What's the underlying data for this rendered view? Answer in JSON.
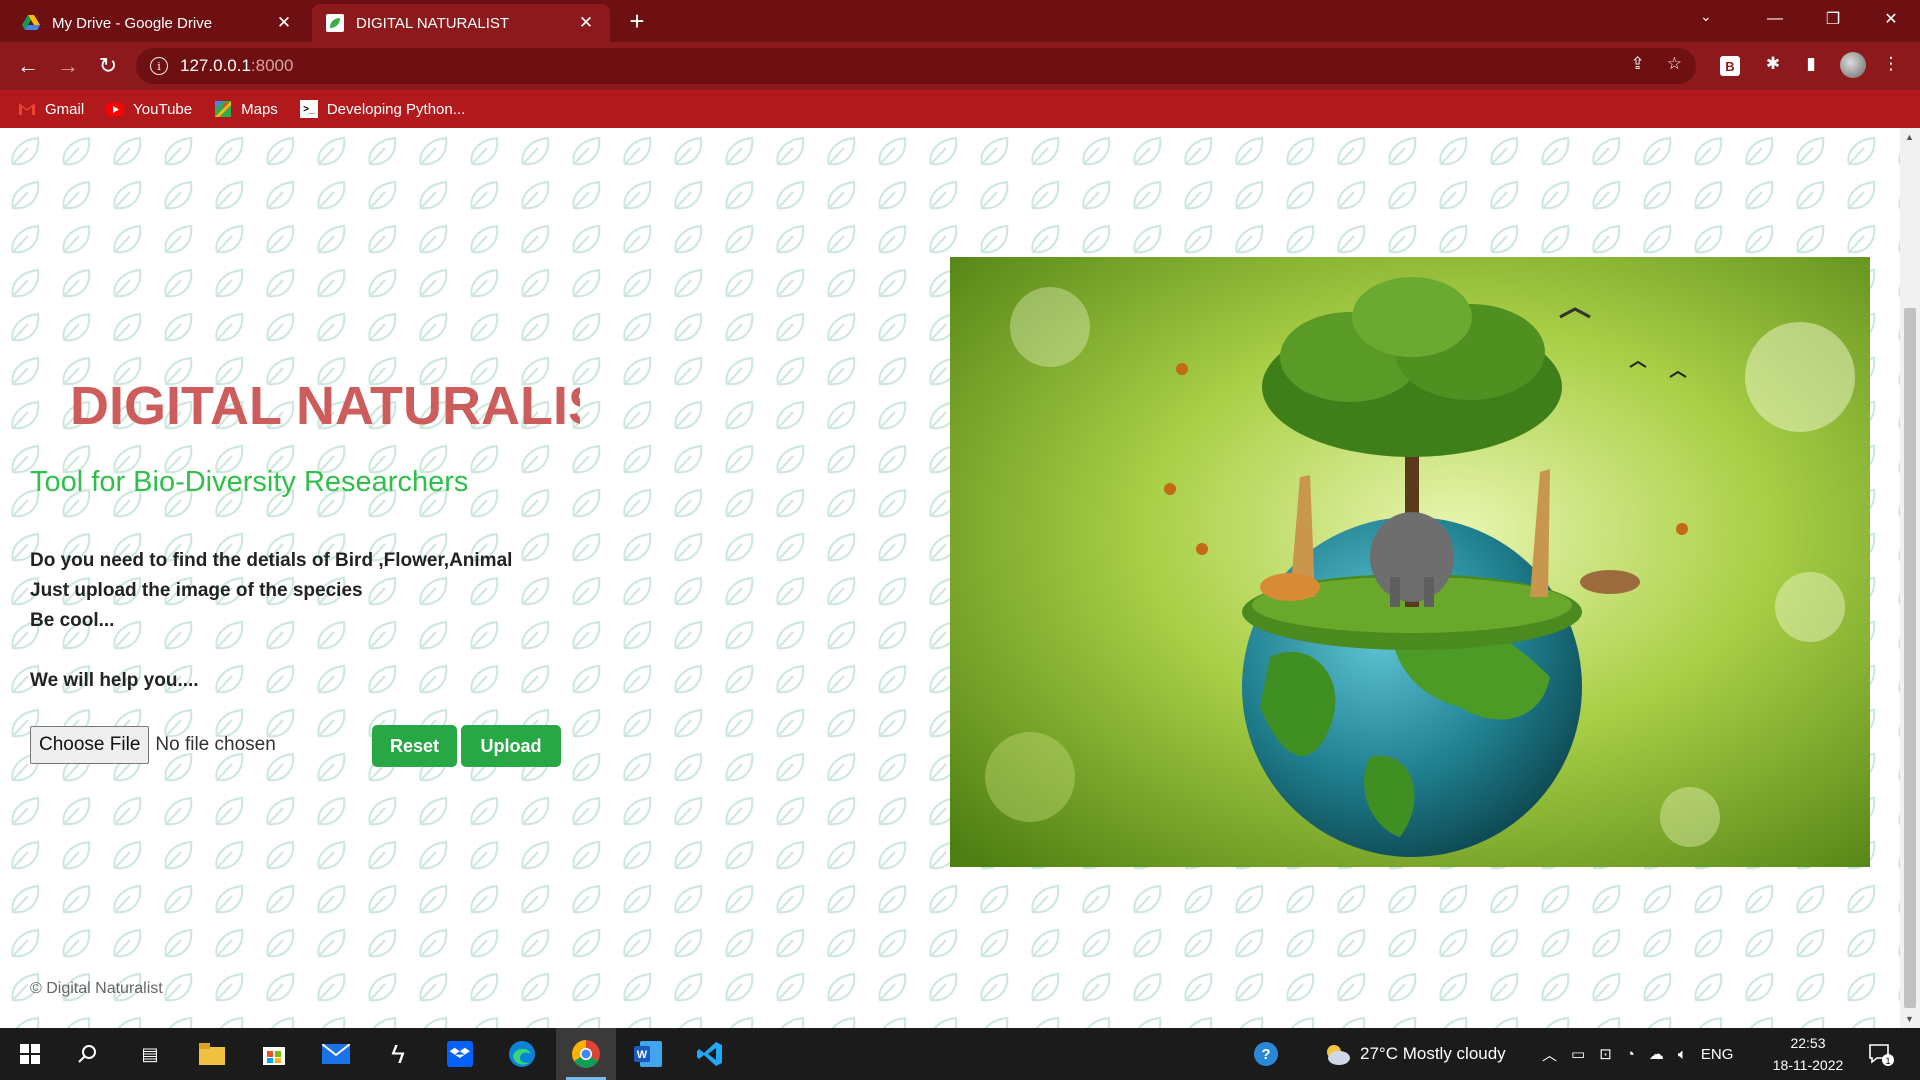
{
  "browser": {
    "tabs": [
      {
        "title": "My Drive - Google Drive",
        "favicon": "google-drive-icon",
        "active": false
      },
      {
        "title": "DIGITAL NATURALIST",
        "favicon": "leaf-favicon",
        "active": true
      }
    ],
    "address": {
      "host": "127.0.0.1",
      "port": ":8000"
    },
    "bookmarks": [
      {
        "label": "Gmail",
        "icon": "gmail-icon"
      },
      {
        "label": "YouTube",
        "icon": "youtube-icon"
      },
      {
        "label": "Maps",
        "icon": "maps-icon"
      },
      {
        "label": "Developing Python...",
        "icon": "terminal-icon"
      }
    ],
    "extension_badge": "B"
  },
  "page": {
    "brand": "DIGITAL NATURALIS",
    "subtitle": "Tool for Bio-Diversity Researchers",
    "intro": {
      "line1": "Do you need to find the detials of Bird ,Flower,Animal",
      "line2": "Just upload the image of the species",
      "line3": "Be cool...",
      "line4": "We will help you...."
    },
    "file_input": {
      "button": "Choose File",
      "status": "No file chosen"
    },
    "reset_label": "Reset",
    "upload_label": "Upload",
    "footer": "© Digital Naturalist",
    "colors": {
      "brand": "#cd5c5c",
      "subtitle": "#2fbf4a",
      "button": "#28a745",
      "chrome": "#8c1a1d"
    }
  },
  "taskbar": {
    "weather": "27°C  Mostly cloudy",
    "language": "ENG",
    "time": "22:53",
    "date": "18-11-2022",
    "notification_count": "1"
  }
}
